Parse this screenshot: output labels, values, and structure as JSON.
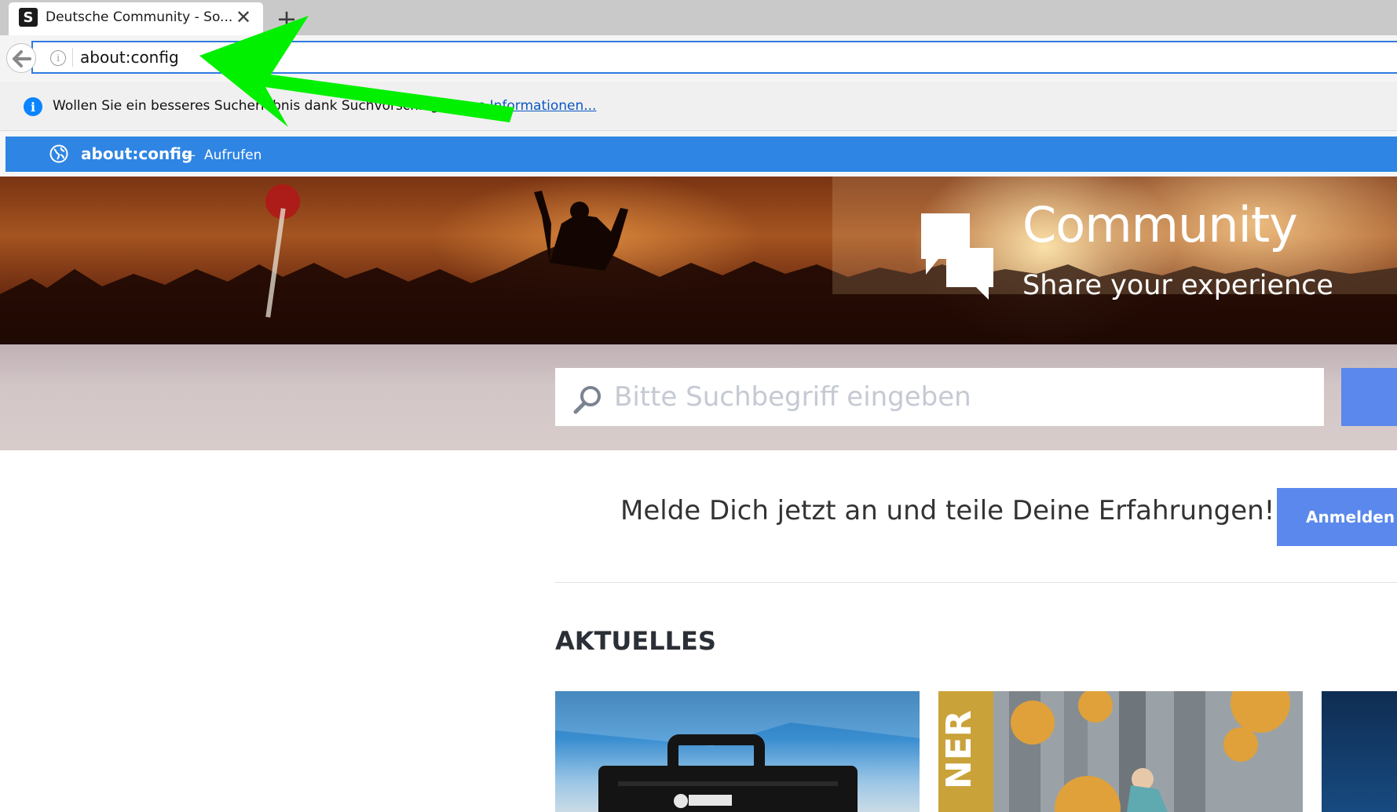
{
  "browser": {
    "tab": {
      "title": "Deutsche Community - So...",
      "favicon_letter": "S",
      "close_icon": "close-icon"
    },
    "new_tab_icon": "plus-icon",
    "back_icon": "arrow-left-icon",
    "url": "about:config",
    "notice": {
      "text": "Wollen Sie ein besseres Sucherlebnis dank Suchvorschlägen?",
      "link": "Weitere Informationen..."
    },
    "suggestion": {
      "url": "about:config",
      "dash": "—",
      "action": "Aufrufen"
    }
  },
  "hero": {
    "title": "Community",
    "subtitle": "Share your experience"
  },
  "search": {
    "placeholder": "Bitte Suchbegriff eingeben"
  },
  "cta": {
    "text": "Melde Dich jetzt an und teile Deine Erfahrungen!",
    "login_label": "Anmelden"
  },
  "section": {
    "title": "AKTUELLES"
  },
  "cards": [
    {
      "name": "card-1"
    },
    {
      "name": "card-2",
      "overlay_text": "NER"
    },
    {
      "name": "card-3"
    }
  ],
  "colors": {
    "accent_blue": "#5a88ec",
    "selection_blue": "#2f85e3",
    "annotation_green": "#00f000"
  }
}
